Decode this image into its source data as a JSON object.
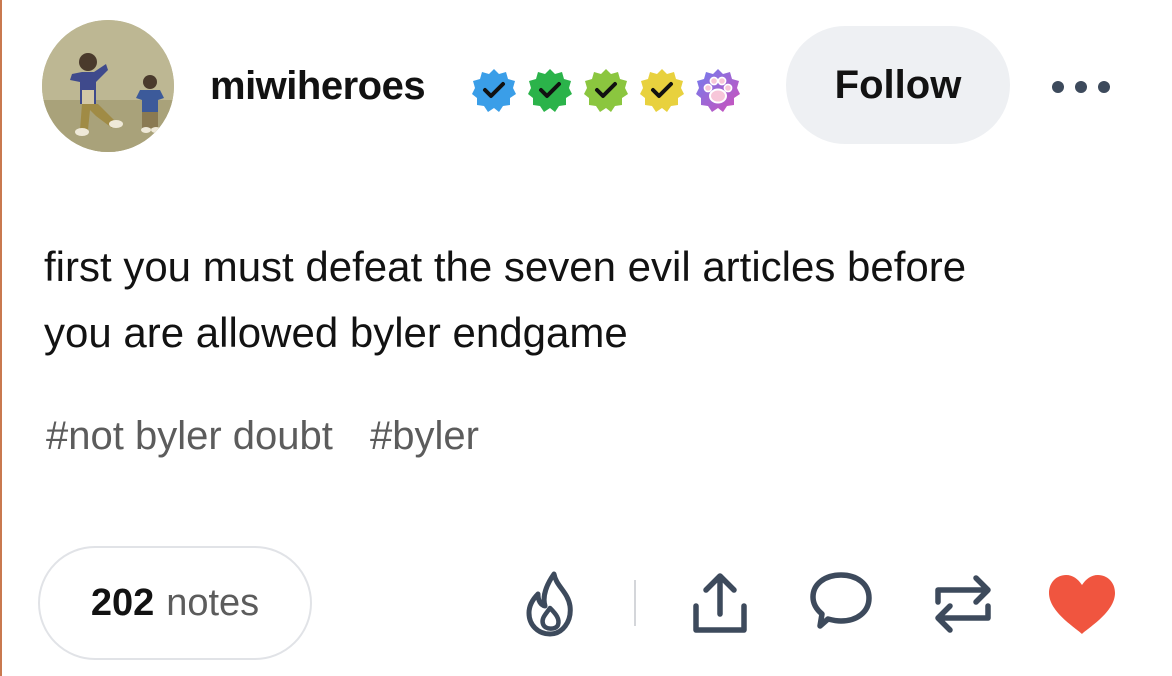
{
  "post": {
    "author": {
      "username": "miwiheroes",
      "avatar": "avatar-photo",
      "badges": [
        {
          "icon": "verified-check-icon",
          "color": "#3a9ee8"
        },
        {
          "icon": "verified-check-icon",
          "color": "#2bb34a"
        },
        {
          "icon": "verified-check-icon",
          "color": "#8bc63f"
        },
        {
          "icon": "verified-check-icon",
          "color": "#e8d13e"
        },
        {
          "icon": "paw-icon",
          "color": "#b45fd6"
        }
      ]
    },
    "follow_label": "Follow",
    "more_icon": "more-dots-icon",
    "text_lines": [
      "first you must defeat the seven evil articles before",
      "you are allowed byler endgame"
    ],
    "tags": [
      "#not byler doubt",
      "#byler"
    ],
    "notes": {
      "count": "202",
      "label": "notes"
    },
    "actions": {
      "blaze": "flame-icon",
      "share": "share-icon",
      "reply": "reply-icon",
      "reblog": "reblog-icon",
      "like": "heart-icon"
    },
    "colors": {
      "like": "#f0553f",
      "icon": "#3d4a5c",
      "follow_bg": "#eef0f3",
      "tag_text": "#5c5c5c"
    }
  }
}
